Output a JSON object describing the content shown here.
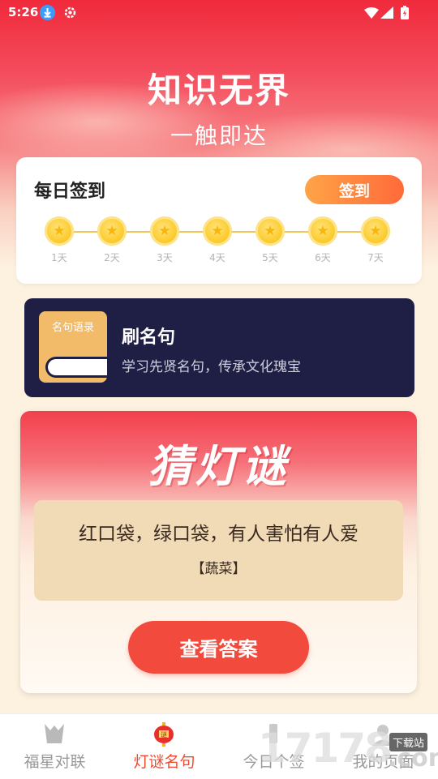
{
  "status_bar": {
    "time": "5:26"
  },
  "hero": {
    "title": "知识无界",
    "subtitle": "一触即达"
  },
  "signin": {
    "title": "每日签到",
    "button_label": "签到",
    "days": [
      "1天",
      "2天",
      "3天",
      "4天",
      "5天",
      "6天",
      "7天"
    ]
  },
  "quote_card": {
    "book_label": "名句语录",
    "title": "刷名句",
    "description": "学习先贤名句，传承文化瑰宝"
  },
  "riddle": {
    "header": "猜灯谜",
    "question": "红口袋，绿口袋，有人害怕有人爱",
    "answer": "【蔬菜】",
    "button_label": "查看答案"
  },
  "tabs": [
    {
      "label": "福星对联",
      "icon": "scroll-icon",
      "active": false
    },
    {
      "label": "灯谜名句",
      "icon": "lantern-icon",
      "active": true
    },
    {
      "label": "今日个签",
      "icon": "sign-icon",
      "active": false
    },
    {
      "label": "我的页面",
      "icon": "profile-icon",
      "active": false
    }
  ],
  "watermark": {
    "number": "17178",
    "suffix": ".com",
    "tag": "下载站"
  },
  "colors": {
    "accent": "#f24a3d",
    "signin_gradient_start": "#ffa447",
    "signin_gradient_end": "#ff6a3a",
    "quote_card_bg": "#1f1f45",
    "coin": "#fccc2f"
  }
}
